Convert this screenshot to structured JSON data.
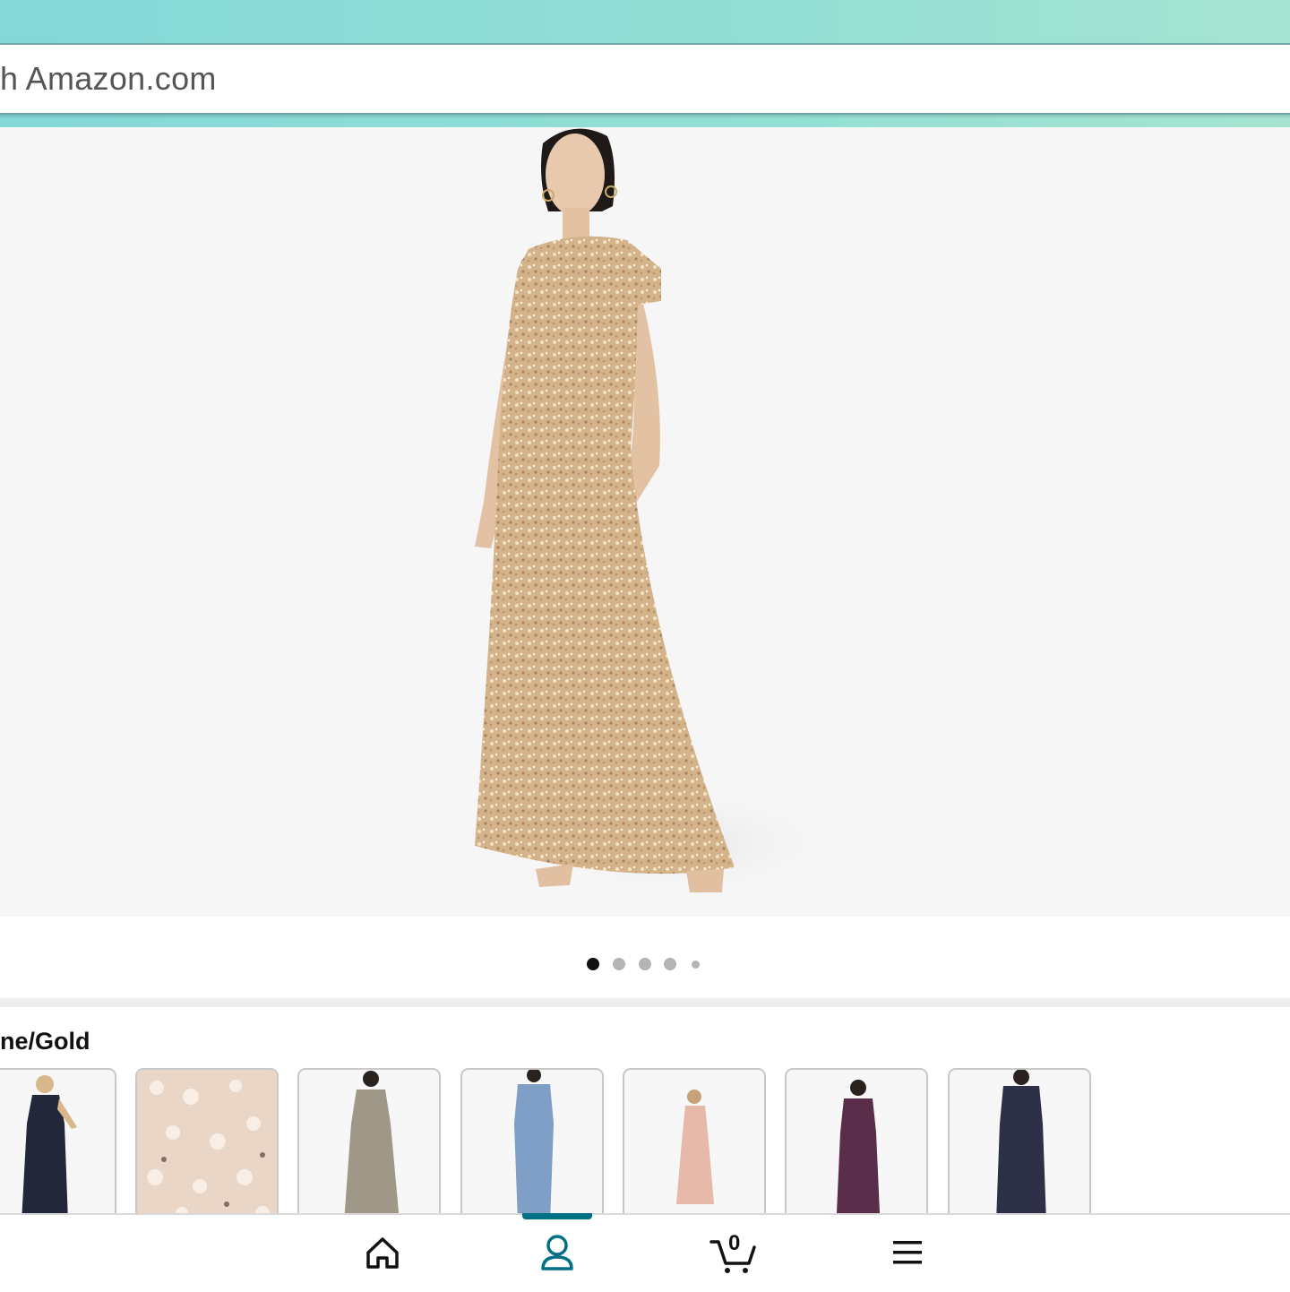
{
  "search": {
    "placeholder_visible": "h Amazon.com"
  },
  "gallery": {
    "image_name": "gold sequin gown on model",
    "page_count": 5,
    "active_page": 1
  },
  "product": {
    "color_label_visible": "ne/Gold",
    "swatches": [
      {
        "name": "navy sequin gown"
      },
      {
        "name": "blush sequin fabric closeup"
      },
      {
        "name": "taupe sequin gown"
      },
      {
        "name": "blue sequin gown"
      },
      {
        "name": "pink sequin gown"
      },
      {
        "name": "plum sequin gown"
      },
      {
        "name": "dark navy sequin gown"
      }
    ]
  },
  "nav": {
    "items": [
      "home-icon",
      "account-icon",
      "cart-icon",
      "menu-icon"
    ],
    "active": "account-icon",
    "cart_count": "0"
  },
  "colors": {
    "header_teal": "#8fdcd6",
    "active_nav": "#007185",
    "gown_gold": "#d2b48c"
  }
}
